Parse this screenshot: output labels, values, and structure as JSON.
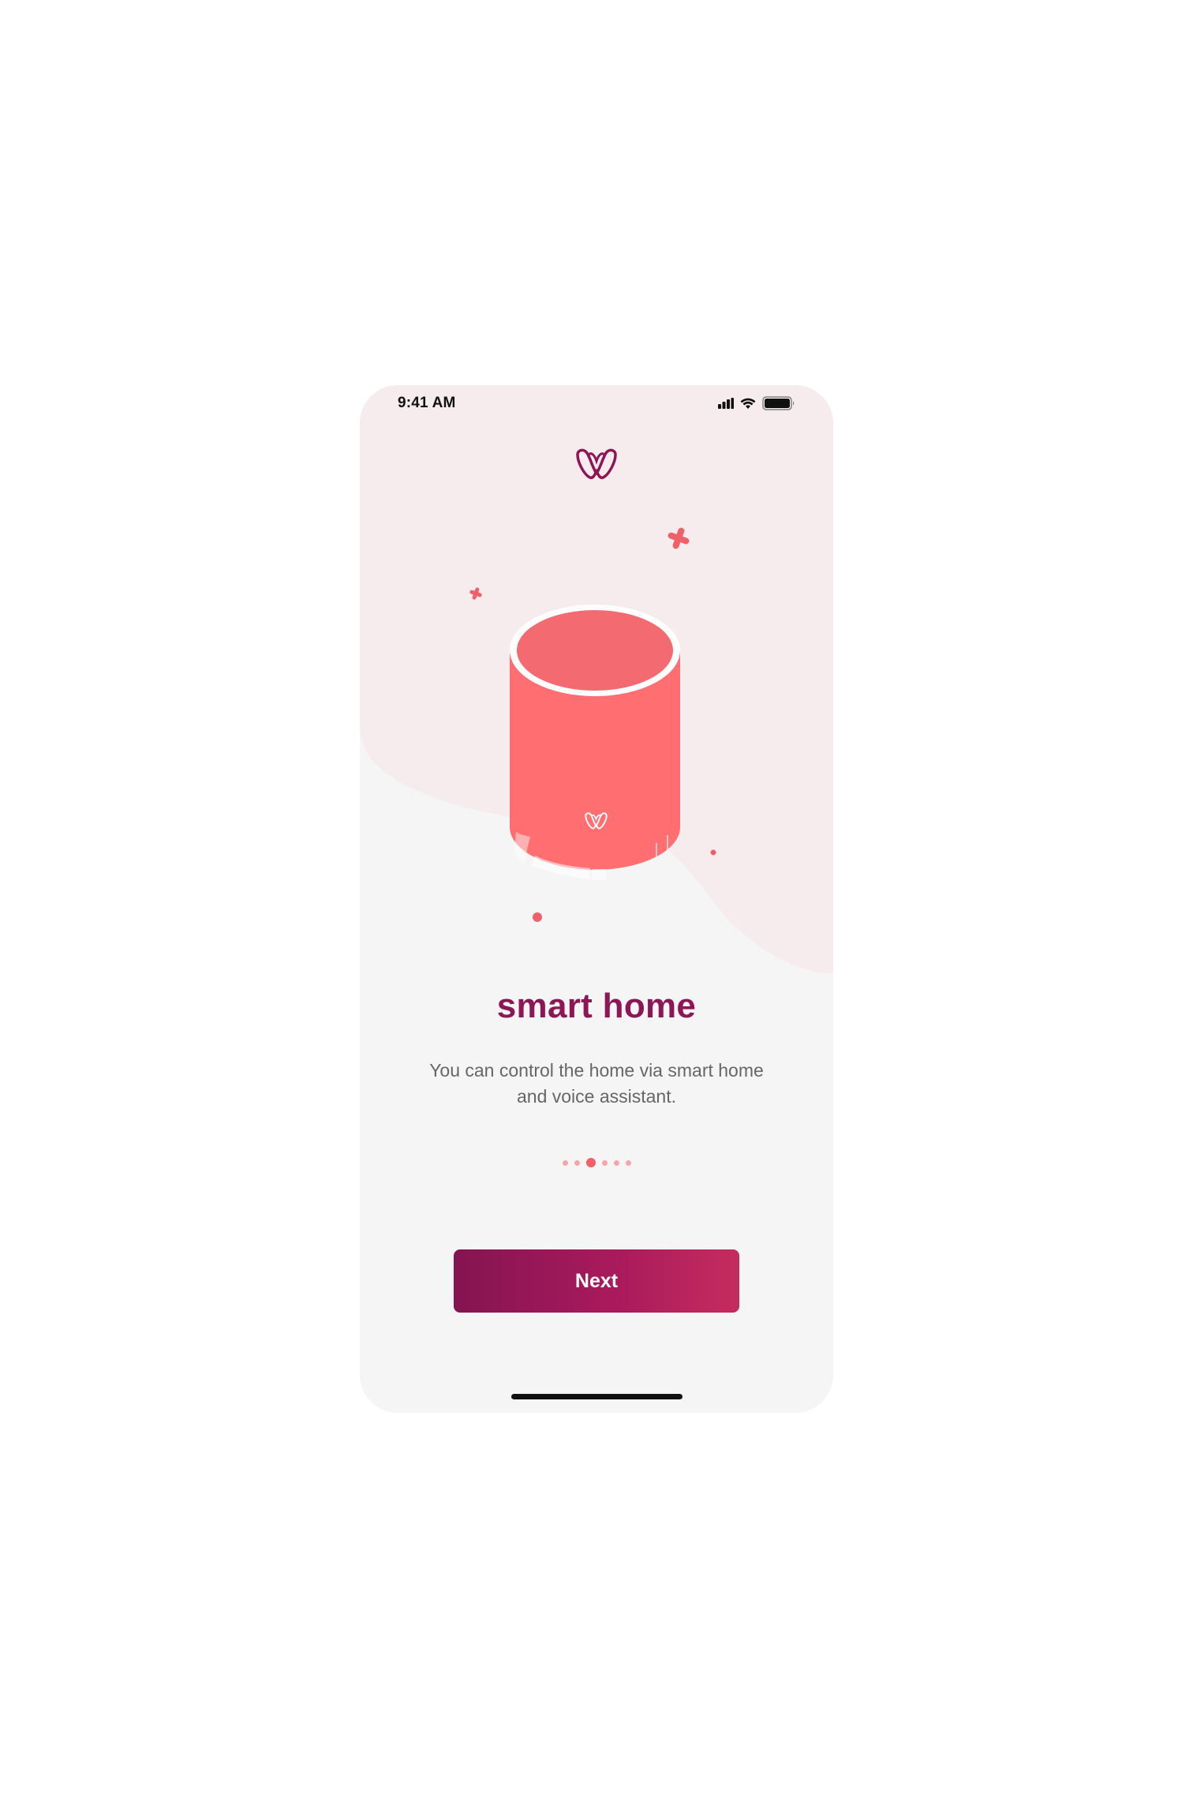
{
  "status_bar": {
    "time": "9:41 AM"
  },
  "logo": {
    "icon": "brand-w-icon"
  },
  "onboarding": {
    "title": "smart home",
    "description": "You can control the home via smart home and voice assistant.",
    "pager": {
      "total": 6,
      "current": 3
    }
  },
  "actions": {
    "next_label": "Next"
  },
  "colors": {
    "primary": "#8d1656",
    "accent": "#ff6f72",
    "speaker_top": "#f36a71",
    "background_pink": "#f6eced",
    "background": "#f5f5f5"
  }
}
